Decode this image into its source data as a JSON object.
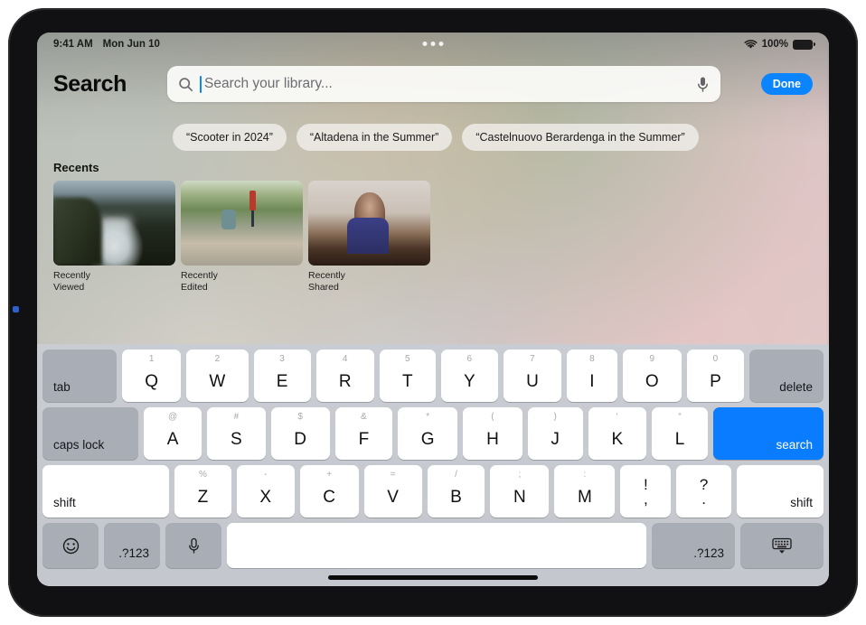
{
  "status_bar": {
    "time": "9:41 AM",
    "date": "Mon Jun 10",
    "battery_percent": "100%",
    "wifi_icon": "wifi-icon",
    "battery_icon": "battery-icon",
    "multitask_icon": "multitasking-dots-icon"
  },
  "header": {
    "title": "Search",
    "done_label": "Done"
  },
  "search": {
    "placeholder": "Search your library...",
    "value": "",
    "search_icon": "magnifying-glass-icon",
    "mic_icon": "microphone-icon"
  },
  "suggestions": [
    {
      "label": "“Scooter in 2024”"
    },
    {
      "label": "“Altadena in the Summer”"
    },
    {
      "label": "“Castelnuovo Berardenga in the Summer”"
    }
  ],
  "recents": {
    "title": "Recents",
    "items": [
      {
        "label": "Recently\nViewed",
        "line1": "Recently",
        "line2": "Viewed"
      },
      {
        "label": "Recently\nEdited",
        "line1": "Recently",
        "line2": "Edited"
      },
      {
        "label": "Recently\nShared",
        "line1": "Recently",
        "line2": "Shared"
      }
    ]
  },
  "keyboard": {
    "accent_color": "#0a7cff",
    "row1": [
      {
        "main": "tab",
        "sub": ""
      },
      {
        "main": "Q",
        "sub": "1"
      },
      {
        "main": "W",
        "sub": "2"
      },
      {
        "main": "E",
        "sub": "3"
      },
      {
        "main": "R",
        "sub": "4"
      },
      {
        "main": "T",
        "sub": "5"
      },
      {
        "main": "Y",
        "sub": "6"
      },
      {
        "main": "U",
        "sub": "7"
      },
      {
        "main": "I",
        "sub": "8"
      },
      {
        "main": "O",
        "sub": "9"
      },
      {
        "main": "P",
        "sub": "0"
      },
      {
        "main": "delete",
        "sub": ""
      }
    ],
    "row2": [
      {
        "main": "caps lock",
        "sub": ""
      },
      {
        "main": "A",
        "sub": "@"
      },
      {
        "main": "S",
        "sub": "#"
      },
      {
        "main": "D",
        "sub": "$"
      },
      {
        "main": "F",
        "sub": "&"
      },
      {
        "main": "G",
        "sub": "*"
      },
      {
        "main": "H",
        "sub": "("
      },
      {
        "main": "J",
        "sub": ")"
      },
      {
        "main": "K",
        "sub": "‘"
      },
      {
        "main": "L",
        "sub": "“"
      },
      {
        "main": "search",
        "sub": ""
      }
    ],
    "row3": [
      {
        "main": "shift",
        "sub": ""
      },
      {
        "main": "Z",
        "sub": "%"
      },
      {
        "main": "X",
        "sub": "-"
      },
      {
        "main": "C",
        "sub": "+"
      },
      {
        "main": "V",
        "sub": "="
      },
      {
        "main": "B",
        "sub": "/"
      },
      {
        "main": "N",
        "sub": ";"
      },
      {
        "main": "M",
        "sub": ":"
      },
      {
        "top": "!",
        "bot": ","
      },
      {
        "top": "?",
        "bot": "."
      },
      {
        "main": "shift",
        "sub": ""
      }
    ],
    "row4": {
      "emoji_icon": "emoji-smiley-icon",
      "numbers_left": ".?123",
      "dictation_icon": "microphone-icon",
      "space": "",
      "numbers_right": ".?123",
      "dismiss_icon": "dismiss-keyboard-icon"
    }
  }
}
